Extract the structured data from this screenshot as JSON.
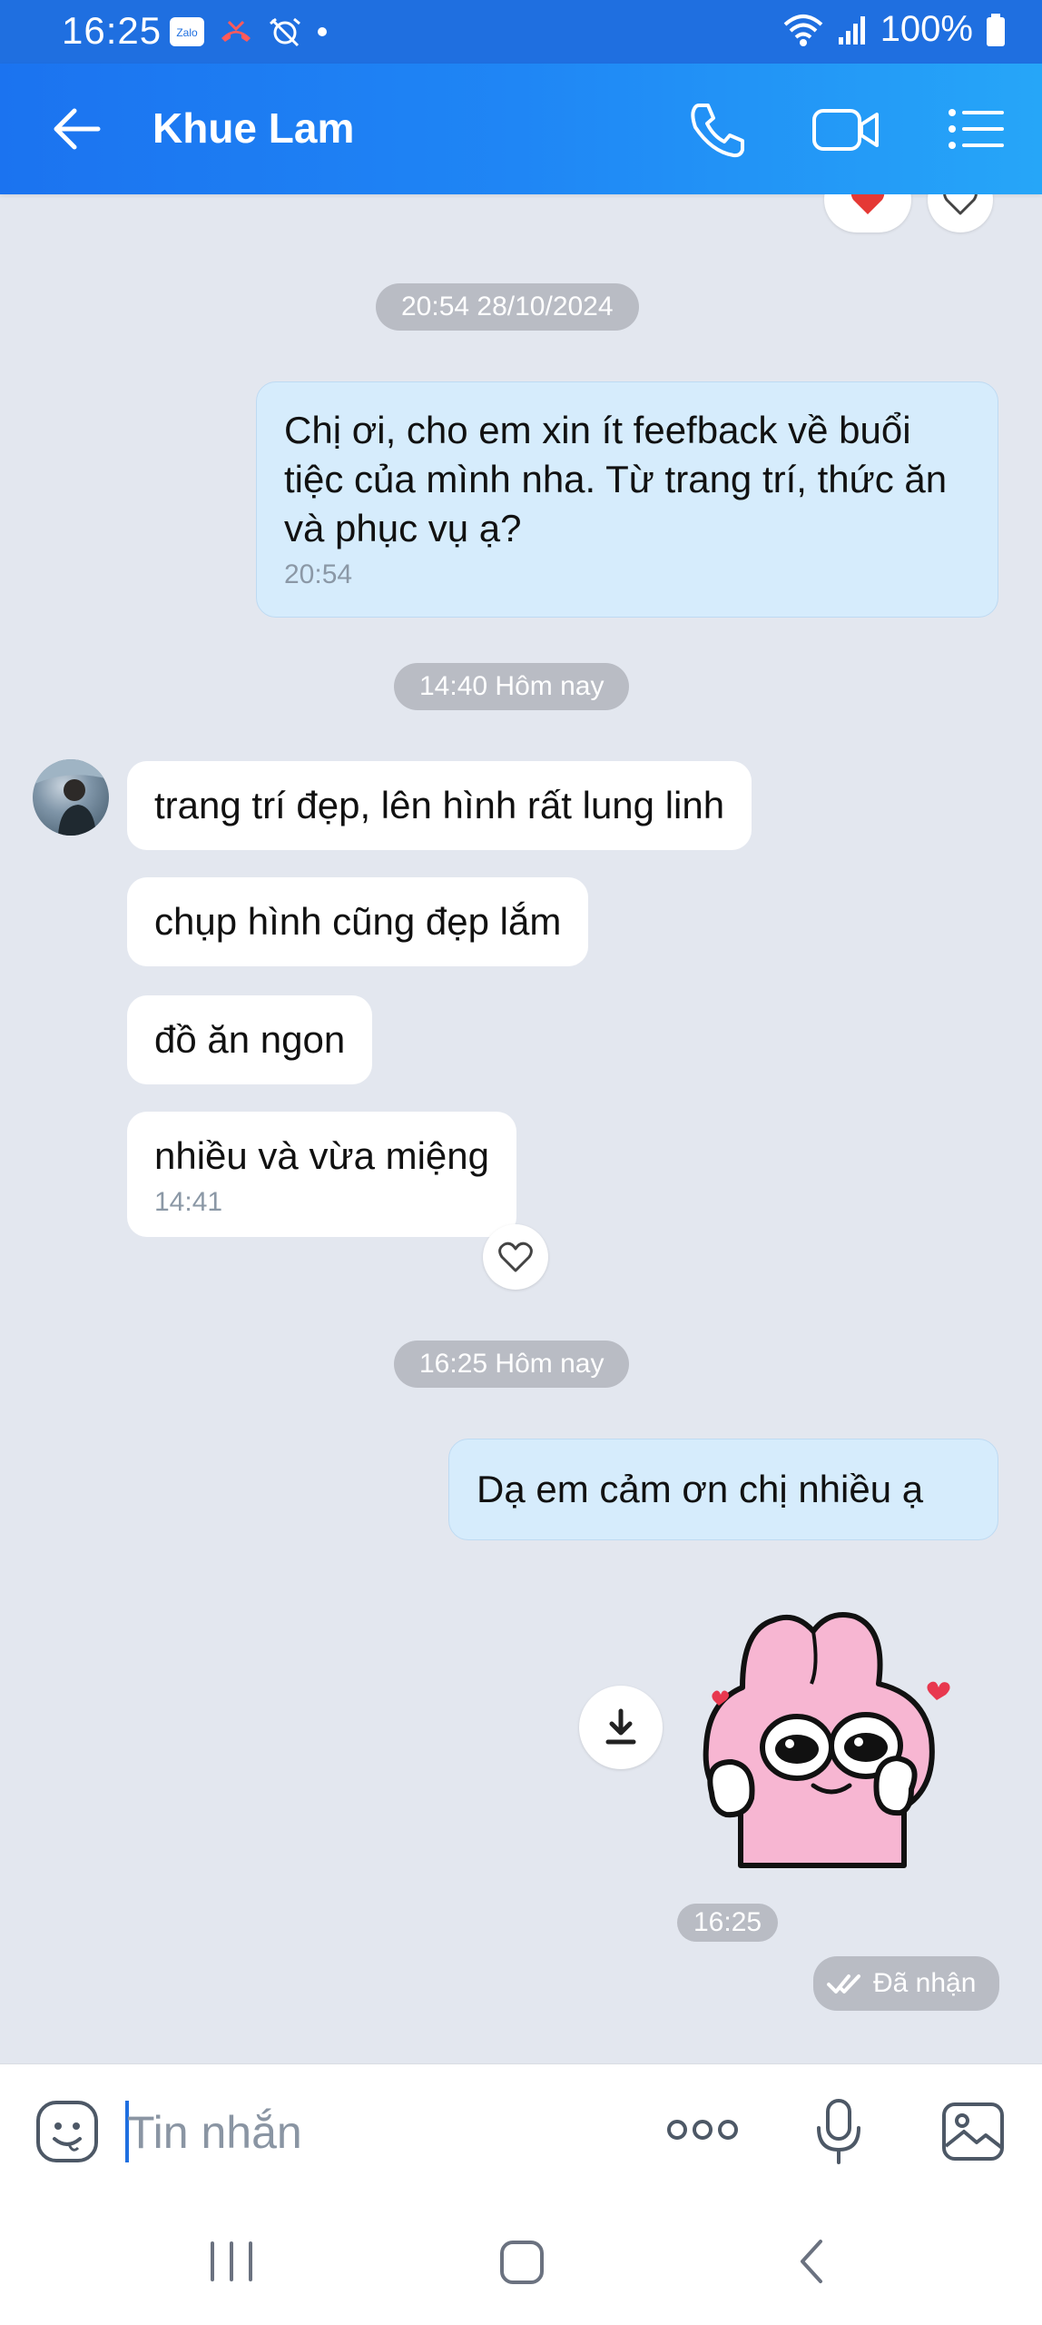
{
  "status_bar": {
    "time": "16:25",
    "battery": "100%"
  },
  "header": {
    "contact_name": "Khue Lam"
  },
  "messages": {
    "date_sep_1": "20:54 28/10/2024",
    "outgoing_1_text": "Chị ơi, cho em xin ít feefback về buổi tiệc của mình nha. Từ trang trí, thức ăn và phục vụ ạ?",
    "outgoing_1_time": "20:54",
    "date_sep_2": "14:40 Hôm nay",
    "incoming_1": "trang trí đẹp, lên hình rất lung linh",
    "incoming_2": "chụp hình cũng đẹp lắm",
    "incoming_3": "đồ ăn ngon",
    "incoming_4": "nhiều và vừa miệng",
    "incoming_4_time": "14:41",
    "date_sep_3": "16:25 Hôm nay",
    "outgoing_2_text": "Dạ em cảm ơn chị nhiều ạ",
    "sticker_time": "16:25",
    "delivery_status": "Đã nhận"
  },
  "input": {
    "placeholder": "Tin nhắn"
  },
  "colors": {
    "header_start": "#1b73f0",
    "header_end": "#26a6f8",
    "chat_bg": "#e3e7ef",
    "outgoing_bubble": "#d6ecfc",
    "incoming_bubble": "#ffffff",
    "sticker_pink": "#f7b6d2"
  },
  "icons": [
    "back-arrow-icon",
    "phone-icon",
    "video-call-icon",
    "menu-list-icon",
    "heart-icon",
    "download-icon",
    "double-check-icon",
    "sticker-emoji-icon",
    "more-dots-icon",
    "microphone-icon",
    "image-icon",
    "recent-apps-icon",
    "home-icon",
    "nav-back-icon"
  ]
}
